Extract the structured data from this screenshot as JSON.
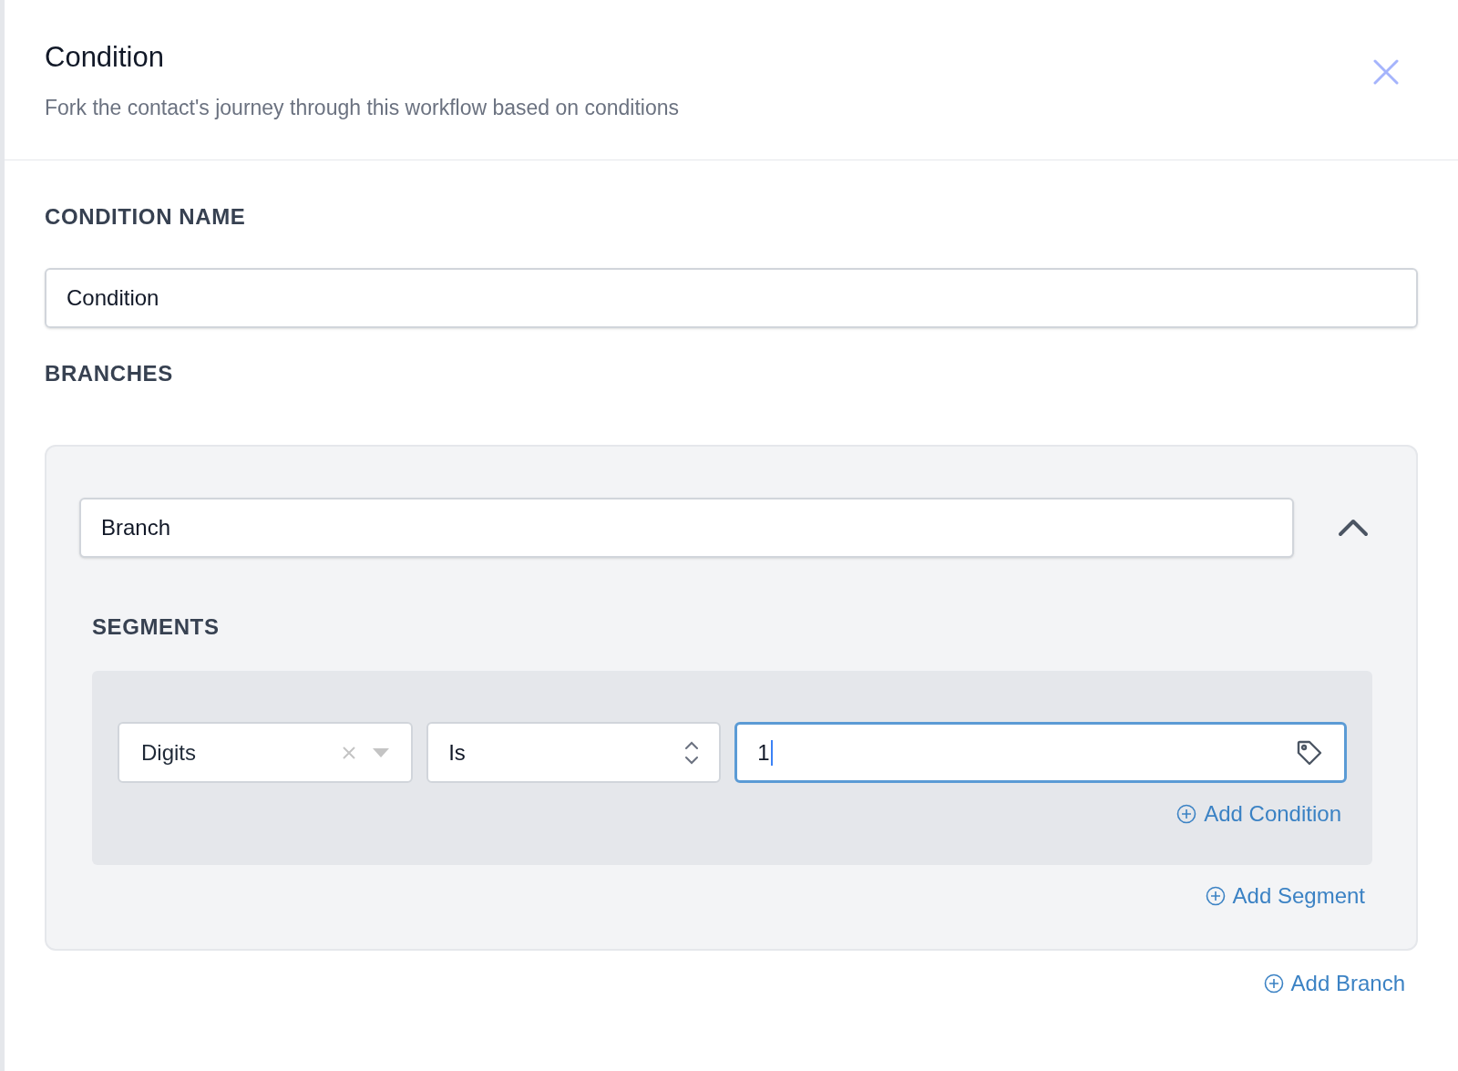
{
  "panel": {
    "title": "Condition",
    "subtitle": "Fork the contact's journey through this workflow based on conditions"
  },
  "condition_name": {
    "label": "CONDITION NAME",
    "value": "Condition"
  },
  "branches": {
    "label": "BRANCHES",
    "items": [
      {
        "name": "Branch",
        "expanded": true,
        "segments_label": "SEGMENTS",
        "segments": [
          {
            "conditions": [
              {
                "field": "Digits",
                "operator": "Is",
                "value": "1",
                "focused": true
              }
            ],
            "add_condition": "Add Condition"
          }
        ],
        "add_segment": "Add Segment"
      }
    ],
    "add_branch": "Add Branch"
  }
}
